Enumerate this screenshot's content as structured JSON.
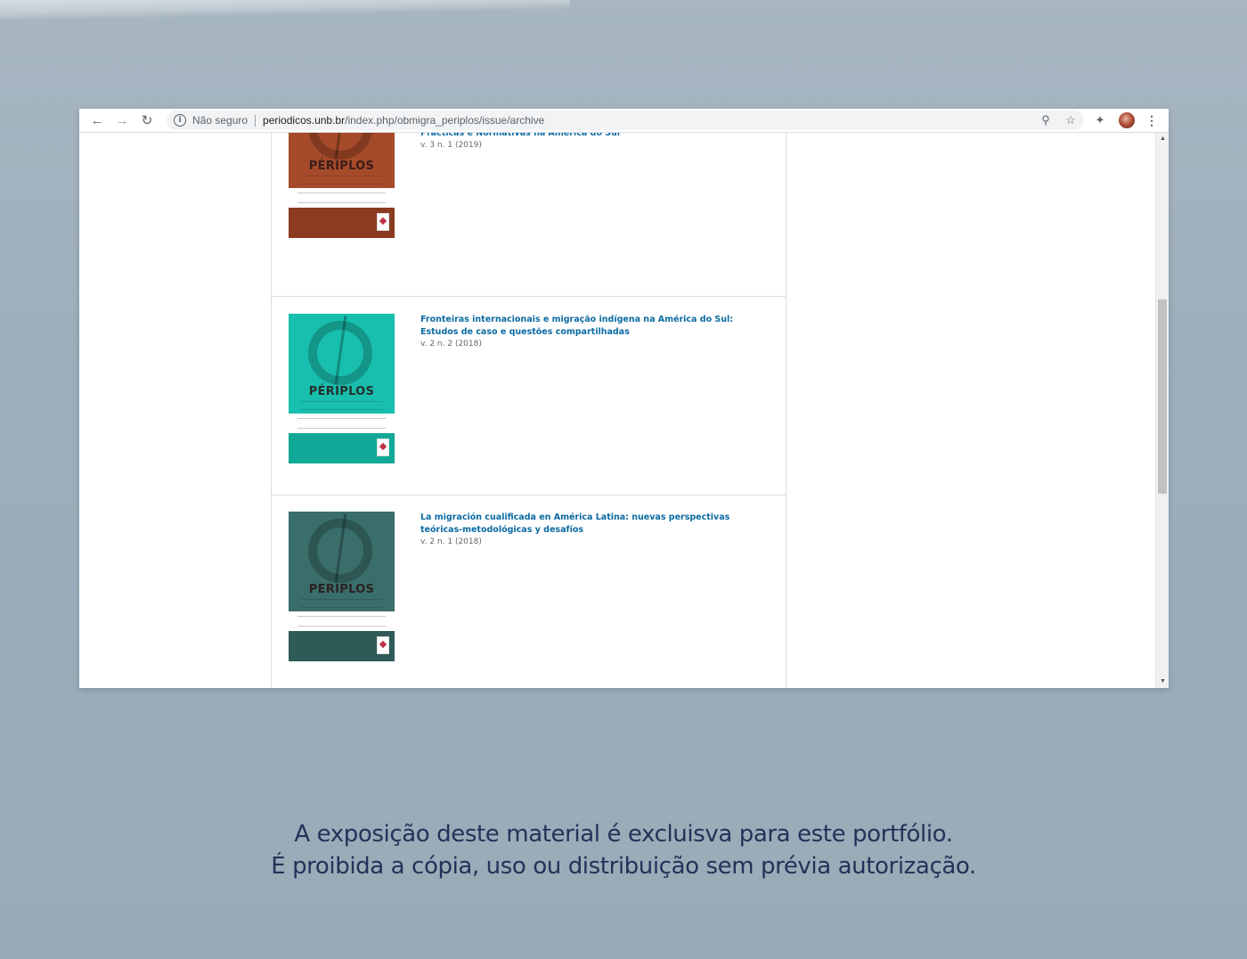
{
  "browser": {
    "security_label": "Não seguro",
    "url_host": "periodicos.unb.br",
    "url_path": "/index.php/obmigra_periplos/issue/archive",
    "icons": {
      "back": "arrow-left-icon",
      "forward": "arrow-right-icon",
      "reload": "reload-icon",
      "info": "info-icon",
      "zoom": "zoom-icon",
      "bookmark": "star-icon",
      "extensions": "puzzle-icon",
      "profile": "avatar",
      "menu": "kebab-menu-icon"
    }
  },
  "archive": {
    "issues": [
      {
        "title": "Prácticas e Normativas na América do Sul",
        "series": "v. 3 n. 1 (2019)",
        "cover_brand": "PÉRIPLOS",
        "cover_color": "#a64b2a",
        "cover_color_dark": "#8b3b20"
      },
      {
        "title": "Fronteiras internacionais e migração indígena na América do Sul: Estudos de caso e questões compartilhadas",
        "series": "v. 2 n. 2 (2018)",
        "cover_brand": "PÉRIPLOS",
        "cover_color": "#19bfae",
        "cover_color_dark": "#12a898"
      },
      {
        "title": "La migración cualificada en América Latina: nuevas perspectivas teóricas-metodológicas y desafíos",
        "series": "v. 2 n. 1 (2018)",
        "cover_brand": "PERIPLOS",
        "cover_color": "#3a6e6a",
        "cover_color_dark": "#2e5b58"
      }
    ]
  },
  "footer": {
    "line1": "A exposição deste material é excluisva para este portfólio.",
    "line2": "É proibida a cópia, uso ou distribuição sem prévia autorização."
  }
}
